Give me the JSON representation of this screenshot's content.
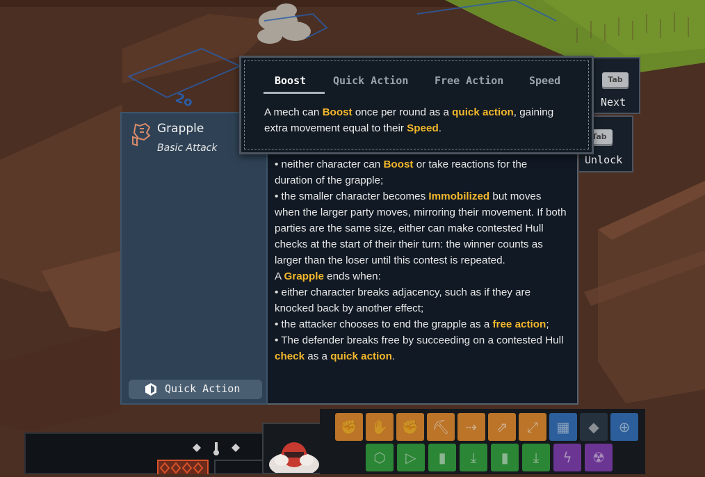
{
  "tooltip": {
    "tabs": [
      {
        "label": "Boost",
        "active": true
      },
      {
        "label": "Quick Action",
        "active": false
      },
      {
        "label": "Free Action",
        "active": false
      },
      {
        "label": "Speed",
        "active": false
      }
    ],
    "text_1": "A mech can ",
    "kw_boost": "Boost",
    "text_2": " once per round as a ",
    "kw_quick_action": "quick action",
    "text_3": ", gaining extra movement equal to their ",
    "kw_speed": "Speed",
    "text_4": "."
  },
  "key_hints": {
    "next": {
      "key": "Tab",
      "label": "Next"
    },
    "unlock": {
      "key": "Tab",
      "label": "Unlock"
    }
  },
  "action_card": {
    "icon": "grapple-fist-icon",
    "name": "Grapple",
    "type": "Basic Attack",
    "cost_icon": "quick-action-hex-icon",
    "cost_label": "Quick Action"
  },
  "description": {
    "l1a": "• neither character can ",
    "l1b": "Boost",
    "l1c": " or take reactions for the duration of the grapple;",
    "l2a": "• the smaller character becomes ",
    "l2b": "Immobilized",
    "l2c": " but moves when the larger party moves, mirroring their movement. If both parties are the same size, either can make contested Hull checks at the start of their their turn: the winner counts as larger than the loser until this contest is repeated.",
    "l3a": "A ",
    "l3b": "Grapple",
    "l3c": " ends when:",
    "l4": "• either character breaks adjacency, such as if they are knocked back by another effect;",
    "l5a": "• the attacker chooses to end the grapple as a ",
    "l5b": "free action",
    "l5c": ";",
    "l6a": "• The defender breaks free by succeeding on a contested Hull ",
    "l6b": "check",
    "l6c": " as a ",
    "l6d": "quick action",
    "l6e": "."
  },
  "hotbar": {
    "slots": [
      {
        "icon": "grapple-icon",
        "color": "#d9842a"
      },
      {
        "icon": "shove-icon",
        "color": "#d9842a"
      },
      {
        "icon": "fist-icon",
        "color": "#d9842a"
      },
      {
        "icon": "pickaxe-icon",
        "color": "#d9842a"
      },
      {
        "icon": "dash-arrows-icon",
        "color": "#d9842a"
      },
      {
        "icon": "disengage-icon",
        "color": "#d9842a"
      },
      {
        "icon": "expand-icon",
        "color": "#d9842a"
      },
      {
        "icon": "grid-icon",
        "color": "#2f6bb0"
      },
      {
        "icon": "diamond-icon",
        "color": "#2a3644"
      },
      {
        "icon": "crosshair-icon",
        "color": "#2f6bb0"
      },
      {
        "icon": "hex-icon",
        "color": "#2f9a3a"
      },
      {
        "icon": "play-icon",
        "color": "#2f9a3a"
      },
      {
        "icon": "canister-icon",
        "color": "#2f9a3a"
      },
      {
        "icon": "download-icon",
        "color": "#2f9a3a"
      },
      {
        "icon": "canister-icon",
        "color": "#2f9a3a"
      },
      {
        "icon": "download-icon",
        "color": "#2f9a3a"
      },
      {
        "icon": "lightning-icon",
        "color": "#7a3aa8"
      },
      {
        "icon": "radiation-icon",
        "color": "#7a3aa8"
      }
    ]
  },
  "colors": {
    "highlight": "#f3b82c",
    "card_bg": "#2f4255",
    "panel_bg": "#111924"
  }
}
